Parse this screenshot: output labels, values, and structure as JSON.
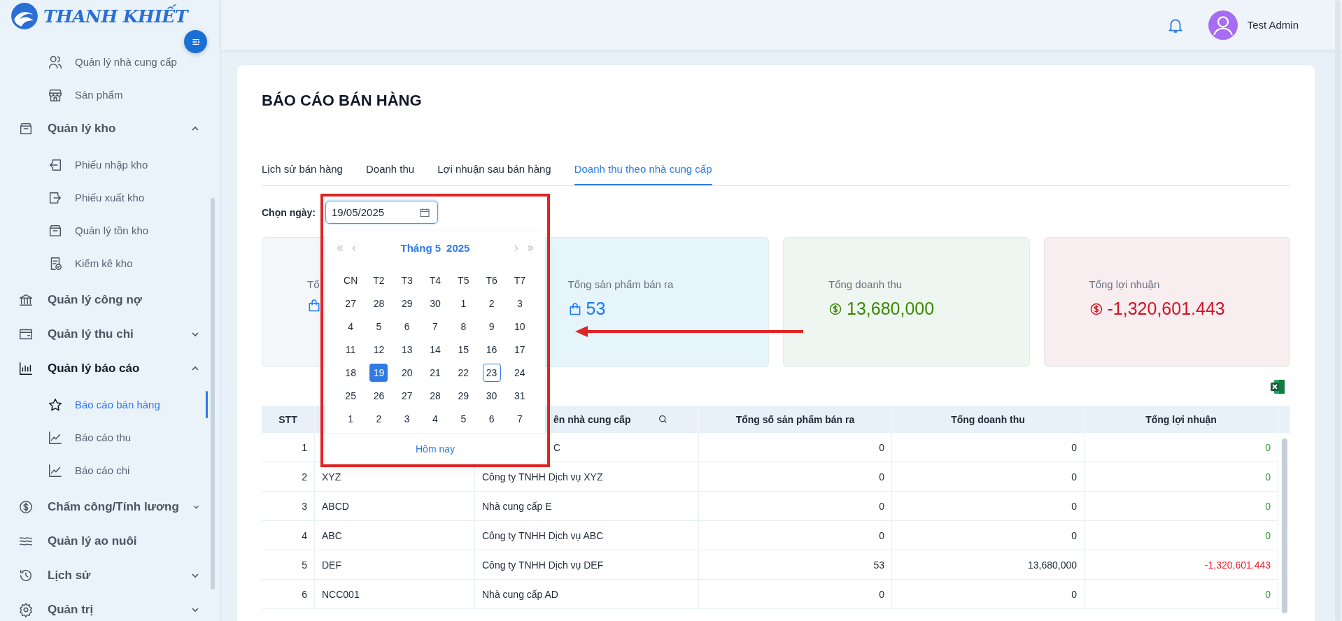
{
  "brand": {
    "name": "THANH KHIẾT"
  },
  "header": {
    "user_name": "Test Admin"
  },
  "sidebar": {
    "continued_children": [
      {
        "label": "Quản lý nhà cung cấp",
        "selected": false
      },
      {
        "label": "Sản phẩm",
        "selected": false
      }
    ],
    "items": [
      {
        "label": "Quản lý kho",
        "kind": "group",
        "expanded": true,
        "selected": false,
        "children": [
          {
            "label": "Phiếu nhập kho",
            "selected": false
          },
          {
            "label": "Phiếu xuất kho",
            "selected": false
          },
          {
            "label": "Quản lý tồn kho",
            "selected": false
          },
          {
            "label": "Kiểm kê kho",
            "selected": false
          }
        ]
      },
      {
        "label": "Quản lý công nợ",
        "kind": "link",
        "selected": false
      },
      {
        "label": "Quản lý thu chi",
        "kind": "group",
        "expanded": false,
        "selected": false
      },
      {
        "label": "Quản lý báo cáo",
        "kind": "group",
        "expanded": true,
        "selected": true,
        "children": [
          {
            "label": "Báo cáo bán hàng",
            "selected": true
          },
          {
            "label": "Báo cáo thu",
            "selected": false
          },
          {
            "label": "Báo cáo chi",
            "selected": false
          }
        ]
      },
      {
        "label": "Chấm công/Tính lương",
        "kind": "group",
        "expanded": false,
        "selected": false
      },
      {
        "label": "Quản lý ao nuôi",
        "kind": "link",
        "selected": false
      },
      {
        "label": "Lịch sử",
        "kind": "group",
        "expanded": false,
        "selected": false
      },
      {
        "label": "Quản trị",
        "kind": "group",
        "expanded": false,
        "selected": false
      }
    ]
  },
  "page": {
    "title": "BÁO CÁO BÁN HÀNG"
  },
  "tabs": [
    {
      "label": "Lịch sử bán hàng",
      "selected": false
    },
    {
      "label": "Doanh thu",
      "selected": false
    },
    {
      "label": "Lợi nhuận sau bán hàng",
      "selected": false
    },
    {
      "label": "Doanh thu theo nhà cung cấp",
      "selected": true
    }
  ],
  "date_filter": {
    "label": "Chọn ngày:",
    "value": "19/05/2025"
  },
  "date_picker": {
    "month_label": "Tháng 5",
    "year_label": "2025",
    "today_button": "Hôm nay",
    "weekdays": [
      "CN",
      "T2",
      "T3",
      "T4",
      "T5",
      "T6",
      "T7"
    ],
    "days": [
      {
        "label": "27",
        "selected": false,
        "today": false
      },
      {
        "label": "28",
        "selected": false,
        "today": false
      },
      {
        "label": "29",
        "selected": false,
        "today": false
      },
      {
        "label": "30",
        "selected": false,
        "today": false
      },
      {
        "label": "1",
        "selected": false,
        "today": false
      },
      {
        "label": "2",
        "selected": false,
        "today": false
      },
      {
        "label": "3",
        "selected": false,
        "today": false
      },
      {
        "label": "4",
        "selected": false,
        "today": false
      },
      {
        "label": "5",
        "selected": false,
        "today": false
      },
      {
        "label": "6",
        "selected": false,
        "today": false
      },
      {
        "label": "7",
        "selected": false,
        "today": false
      },
      {
        "label": "8",
        "selected": false,
        "today": false
      },
      {
        "label": "9",
        "selected": false,
        "today": false
      },
      {
        "label": "10",
        "selected": false,
        "today": false
      },
      {
        "label": "11",
        "selected": false,
        "today": false
      },
      {
        "label": "12",
        "selected": false,
        "today": false
      },
      {
        "label": "13",
        "selected": false,
        "today": false
      },
      {
        "label": "14",
        "selected": false,
        "today": false
      },
      {
        "label": "15",
        "selected": false,
        "today": false
      },
      {
        "label": "16",
        "selected": false,
        "today": false
      },
      {
        "label": "17",
        "selected": false,
        "today": false
      },
      {
        "label": "18",
        "selected": false,
        "today": false
      },
      {
        "label": "19",
        "selected": true,
        "today": false
      },
      {
        "label": "20",
        "selected": false,
        "today": false
      },
      {
        "label": "21",
        "selected": false,
        "today": false
      },
      {
        "label": "22",
        "selected": false,
        "today": false
      },
      {
        "label": "23",
        "selected": false,
        "today": true
      },
      {
        "label": "24",
        "selected": false,
        "today": false
      },
      {
        "label": "25",
        "selected": false,
        "today": false
      },
      {
        "label": "26",
        "selected": false,
        "today": false
      },
      {
        "label": "27",
        "selected": false,
        "today": false
      },
      {
        "label": "28",
        "selected": false,
        "today": false
      },
      {
        "label": "29",
        "selected": false,
        "today": false
      },
      {
        "label": "30",
        "selected": false,
        "today": false
      },
      {
        "label": "31",
        "selected": false,
        "today": false
      },
      {
        "label": "1",
        "selected": false,
        "today": false
      },
      {
        "label": "2",
        "selected": false,
        "today": false
      },
      {
        "label": "3",
        "selected": false,
        "today": false
      },
      {
        "label": "4",
        "selected": false,
        "today": false
      },
      {
        "label": "5",
        "selected": false,
        "today": false
      },
      {
        "label": "6",
        "selected": false,
        "today": false
      },
      {
        "label": "7",
        "selected": false,
        "today": false
      }
    ]
  },
  "summary_cards": [
    {
      "title": "Tổ",
      "kind": "items",
      "color": "#1677ff"
    },
    {
      "title": "Tổng sản phẩm bán ra",
      "value": "53",
      "kind": "items",
      "color": "#1677ff"
    },
    {
      "title": "Tổng doanh thu",
      "value": "13,680,000",
      "kind": "money",
      "color": "#3f8600"
    },
    {
      "title": "Tổng lợi nhuận",
      "value": "-1,320,601.443",
      "kind": "money",
      "color": "#cf1322"
    }
  ],
  "table": {
    "columns": [
      {
        "label": "STT",
        "kind": "plain"
      },
      {
        "kind": "covered"
      },
      {
        "label": "ên nhà cung cấp",
        "kind": "search"
      },
      {
        "label": "Tổng số sản phẩm bán ra",
        "kind": "plain"
      },
      {
        "label": "Tổng doanh thu",
        "kind": "plain"
      },
      {
        "label": "Tổng lợi nhuận",
        "kind": "plain"
      }
    ],
    "rows": [
      {
        "stt": "1",
        "name": "C",
        "products": "0",
        "revenue": "0",
        "profit": "0",
        "color": "#2e9b2e",
        "partial": true
      },
      {
        "stt": "2",
        "code": "XYZ",
        "name": "Công ty TNHH Dịch vụ XYZ",
        "products": "0",
        "revenue": "0",
        "profit": "0",
        "color": "#2e9b2e",
        "partial": false
      },
      {
        "stt": "3",
        "code": "ABCD",
        "name": "Nhà cung cấp E",
        "products": "0",
        "revenue": "0",
        "profit": "0",
        "color": "#2e9b2e",
        "partial": false
      },
      {
        "stt": "4",
        "code": "ABC",
        "name": "Công ty TNHH Dịch vụ ABC",
        "products": "0",
        "revenue": "0",
        "profit": "0",
        "color": "#2e9b2e",
        "partial": false
      },
      {
        "stt": "5",
        "code": "DEF",
        "name": "Công ty TNHH Dịch vụ DEF",
        "products": "53",
        "revenue": "13,680,000",
        "profit": "-1,320,601.443",
        "color": "#f5222d",
        "partial": false
      },
      {
        "stt": "6",
        "code": "NCC001",
        "name": "Nhà cung cấp AD",
        "products": "0",
        "revenue": "0",
        "profit": "0",
        "color": "#2e9b2e",
        "partial": false
      }
    ]
  }
}
